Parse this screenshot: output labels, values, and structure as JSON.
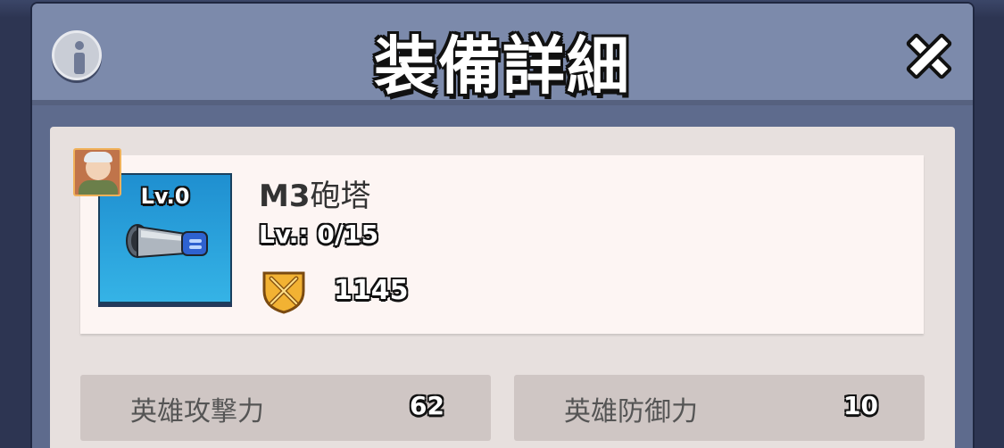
{
  "header": {
    "title": "装備詳細",
    "info_icon": "info-icon",
    "close_icon": "close-icon"
  },
  "item": {
    "tile_level": "Lv.0",
    "name_prefix": "M3",
    "name_suffix": "砲塔",
    "level_text": "Lv.: 0/15",
    "power": "1145",
    "icon": "turret-barrel-icon",
    "hero_icon": "hero-portrait-icon",
    "power_icon": "power-emblem-icon"
  },
  "stats": [
    {
      "label": "英雄攻撃力",
      "value": "62"
    },
    {
      "label": "英雄防御力",
      "value": "10"
    }
  ],
  "colors": {
    "header": "#7c8aab",
    "panel": "#e7e0de",
    "tile": "#2aa3dc",
    "stat_bg": "#cfc6c4"
  }
}
